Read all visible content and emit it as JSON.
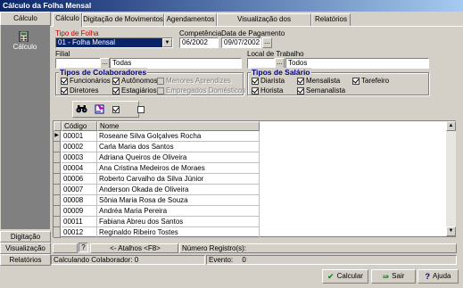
{
  "window": {
    "title": "Cálculo da Folha Mensal"
  },
  "sidebar": {
    "header": "Cálculo",
    "item_label": "Cálculo",
    "bottom": [
      "Digitação",
      "Visualização",
      "Relatórios"
    ]
  },
  "tabs": [
    "Cálculo",
    "Digitação de Movimentos",
    "Agendamentos",
    "Visualização dos Movimentos",
    "Relatórios"
  ],
  "form": {
    "tipo_folha_label": "Tipo de Folha",
    "tipo_folha_value": "01 - Folha Mensal",
    "competencia_label": "Competência",
    "competencia_value": "06/2002",
    "data_pagamento_label": "Data de Pagamento",
    "data_pagamento_value": "09/07/2002",
    "filial_label": "Filial",
    "filial_value": "Todas",
    "local_label": "Local de Trabalho",
    "local_value": "Todos",
    "ellipsis": "..."
  },
  "tipos_colaboradores": {
    "title": "Tipos de Colaboradores",
    "items": [
      {
        "label": "Funcionários",
        "checked": true,
        "disabled": false
      },
      {
        "label": "Autônomos",
        "checked": true,
        "disabled": false
      },
      {
        "label": "Menores Aprendizes",
        "checked": false,
        "disabled": true
      },
      {
        "label": "Diretores",
        "checked": true,
        "disabled": false
      },
      {
        "label": "Estagiários",
        "checked": true,
        "disabled": false
      },
      {
        "label": "Empregados Domésticos",
        "checked": false,
        "disabled": true
      }
    ]
  },
  "tipos_salario": {
    "title": "Tipos de Salário",
    "items": [
      {
        "label": "Diarista",
        "checked": true
      },
      {
        "label": "Mensalista",
        "checked": true
      },
      {
        "label": "Tarefeiro",
        "checked": true
      },
      {
        "label": "Horista",
        "checked": true
      },
      {
        "label": "Semanalista",
        "checked": true
      }
    ]
  },
  "grid": {
    "columns": [
      "Código",
      "Nome"
    ],
    "rows": [
      [
        "00001",
        "Roseane Silva Golçalves Rocha"
      ],
      [
        "00002",
        "Carla Maria dos Santos"
      ],
      [
        "00003",
        "Adriana Queiros de Oliveira"
      ],
      [
        "00004",
        "Ana Cristina Medeiros de Moraes"
      ],
      [
        "00006",
        "Roberto Carvalho da Silva Júnior"
      ],
      [
        "00007",
        "Anderson Okada de Oliveira"
      ],
      [
        "00008",
        "Sônia Maria Rosa de Souza"
      ],
      [
        "00009",
        "Andréa Maria Pereira"
      ],
      [
        "00011",
        "Fabiana Abreu dos Santos"
      ],
      [
        "00012",
        "Reginaldo Ribeiro Tostes"
      ]
    ]
  },
  "status": {
    "help": "?",
    "atalhos": "<- Atalhos <F8>",
    "numero_registro": "Número Registro(s):",
    "calculando": "Calculando Colaborador:",
    "calculando_value": "0",
    "evento": "Evento:",
    "evento_value": "0"
  },
  "buttons": {
    "calcular": "Calcular",
    "sair": "Sair",
    "ajuda": "Ajuda"
  }
}
